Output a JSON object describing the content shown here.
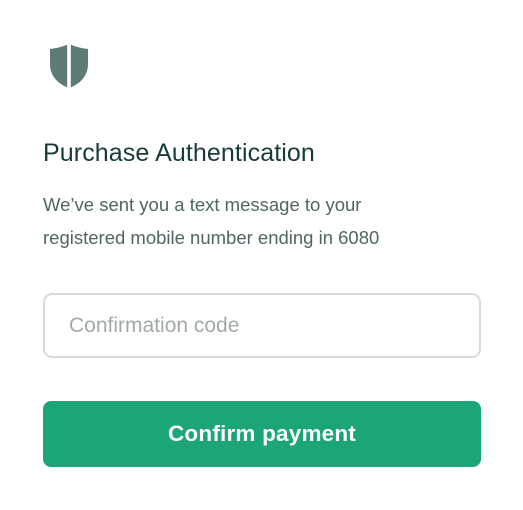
{
  "header": {
    "icon": "shield-icon",
    "icon_color": "#5f7b76"
  },
  "auth": {
    "title": "Purchase Authentication",
    "message_line1": "We’ve sent you a text message to your",
    "message_line2": "registered mobile number ending in 6080"
  },
  "form": {
    "code_value": "",
    "code_placeholder": "Confirmation code",
    "confirm_label": "Confirm payment",
    "confirm_color": "#1ca676"
  }
}
